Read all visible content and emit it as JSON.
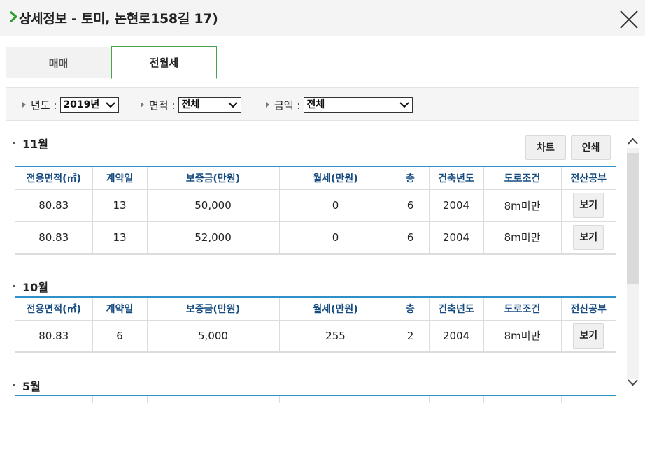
{
  "header": {
    "title": "상세정보 - 토미, 논현로158길 17)",
    "accent": "#2a9d2a"
  },
  "tabs": [
    {
      "label": "매매",
      "active": false
    },
    {
      "label": "전월세",
      "active": true
    }
  ],
  "filters": {
    "year": {
      "label": "년도 :",
      "value": "2019년"
    },
    "area": {
      "label": "면적 :",
      "value": "전체"
    },
    "price": {
      "label": "금액 :",
      "value": "전체"
    }
  },
  "buttons": {
    "chart": "차트",
    "print": "인쇄"
  },
  "table_headers": [
    "전용면적(㎡)",
    "계약일",
    "보증금(만원)",
    "월세(만원)",
    "층",
    "건축년도",
    "도로조건",
    "전산공부"
  ],
  "sections": [
    {
      "month": "11월",
      "rows": [
        {
          "area": "80.83",
          "day": "13",
          "deposit": "50,000",
          "rent": "0",
          "floor": "6",
          "year": "2004",
          "road": "8m미만",
          "action": "보기"
        },
        {
          "area": "80.83",
          "day": "13",
          "deposit": "52,000",
          "rent": "0",
          "floor": "6",
          "year": "2004",
          "road": "8m미만",
          "action": "보기"
        }
      ]
    },
    {
      "month": "10월",
      "rows": [
        {
          "area": "80.83",
          "day": "6",
          "deposit": "5,000",
          "rent": "255",
          "floor": "2",
          "year": "2004",
          "road": "8m미만",
          "action": "보기"
        }
      ]
    },
    {
      "month": "5월",
      "rows": []
    }
  ],
  "colors": {
    "header_text": "#174c80",
    "table_border_top": "#2f8fc7",
    "active_tab_border": "#4aa34a"
  }
}
